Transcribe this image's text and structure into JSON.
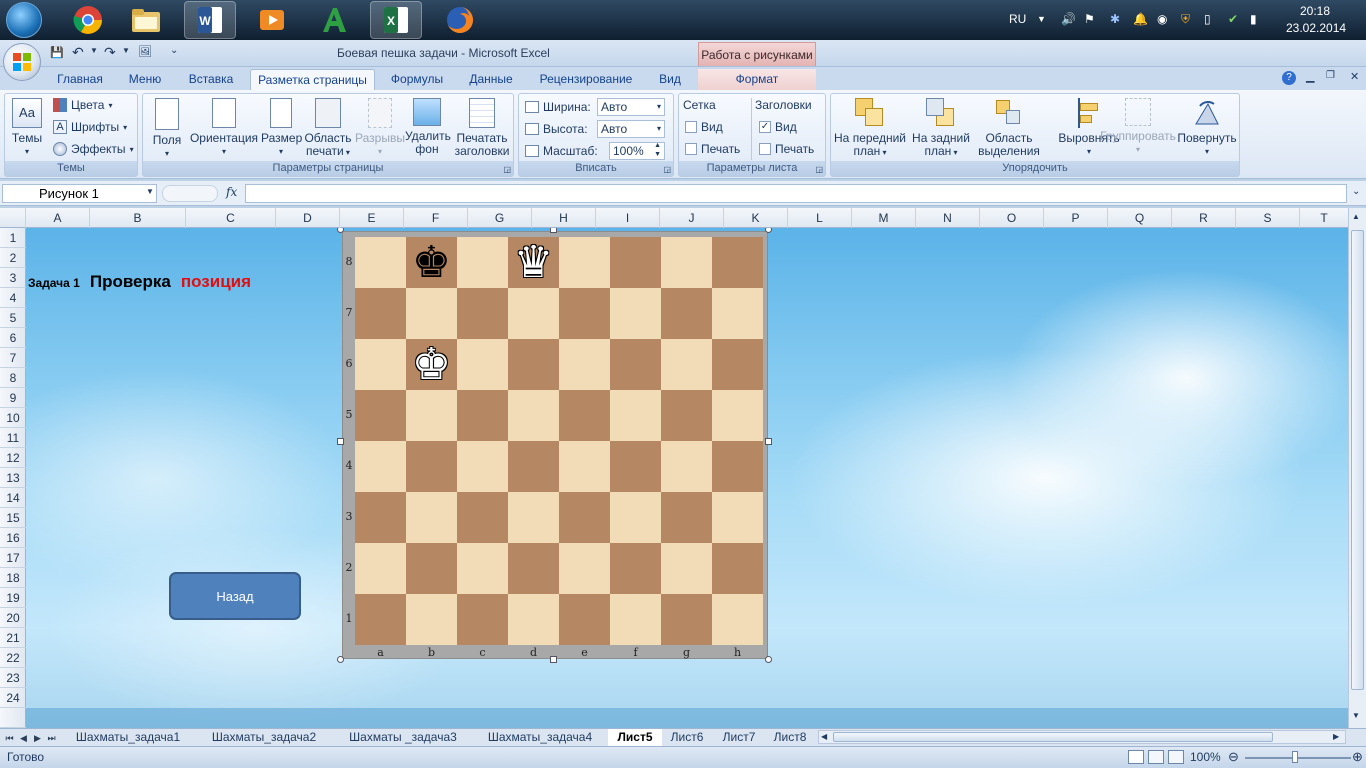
{
  "taskbar": {
    "apps": [
      {
        "icon": "chrome-icon"
      },
      {
        "icon": "file-explorer-icon"
      },
      {
        "icon": "word-icon"
      },
      {
        "icon": "media-player-icon"
      },
      {
        "icon": "font-a-icon"
      },
      {
        "icon": "excel-icon"
      },
      {
        "icon": "firefox-icon"
      }
    ],
    "lang": "RU",
    "time": "20:18",
    "date": "23.02.2014"
  },
  "window": {
    "title": "Боевая пешка задачи - Microsoft Excel",
    "context_tab": "Работа с рисунками"
  },
  "ribbon_tabs": [
    "Главная",
    "Меню",
    "Вставка",
    "Разметка страницы",
    "Формулы",
    "Данные",
    "Рецензирование",
    "Вид",
    "Формат"
  ],
  "ribbon": {
    "themes": {
      "label": "Темы",
      "themes_btn": "Темы",
      "colors": "Цвета",
      "fonts": "Шрифты",
      "effects": "Эффекты"
    },
    "page_setup": {
      "label": "Параметры страницы",
      "margins": "Поля",
      "orientation": "Ориентация",
      "size": "Размер",
      "print_area_1": "Область",
      "print_area_2": "печати",
      "breaks": "Разрывы",
      "background_1": "Удалить",
      "background_2": "фон",
      "print_titles_1": "Печатать",
      "print_titles_2": "заголовки"
    },
    "scale_to_fit": {
      "label": "Вписать",
      "width_label": "Ширина:",
      "width_value": "Авто",
      "height_label": "Высота:",
      "height_value": "Авто",
      "scale_label": "Масштаб:",
      "scale_value": "100%"
    },
    "sheet_options": {
      "label": "Параметры листа",
      "gridlines": "Сетка",
      "headings": "Заголовки",
      "view": "Вид",
      "print": "Печать",
      "gridlines_view_checked": false,
      "gridlines_print_checked": false,
      "headings_view_checked": true,
      "headings_print_checked": false
    },
    "arrange": {
      "label": "Упорядочить",
      "bring_forward_1": "На передний",
      "bring_forward_2": "план",
      "send_backward_1": "На задний",
      "send_backward_2": "план",
      "selection_pane_1": "Область",
      "selection_pane_2": "выделения",
      "align": "Выровнять",
      "group": "Группировать",
      "rotate": "Повернуть"
    }
  },
  "formula_bar": {
    "name_box": "Рисунок 1",
    "fx": "fx",
    "formula": ""
  },
  "columns": [
    "A",
    "B",
    "C",
    "D",
    "E",
    "F",
    "G",
    "H",
    "I",
    "J",
    "K",
    "L",
    "M",
    "N",
    "O",
    "P",
    "Q",
    "R",
    "S",
    "T"
  ],
  "rows": [
    "1",
    "2",
    "3",
    "4",
    "5",
    "6",
    "7",
    "8",
    "9",
    "10",
    "11",
    "12",
    "13",
    "14",
    "15",
    "16",
    "17",
    "18",
    "19",
    "20",
    "21",
    "22",
    "23",
    "24"
  ],
  "sheet_content": {
    "task_label": "Задача 1",
    "title_word1": "Проверка",
    "title_word2": "позиция",
    "back_button": "Назад"
  },
  "chess": {
    "ranks": [
      "8",
      "7",
      "6",
      "5",
      "4",
      "3",
      "2",
      "1"
    ],
    "files": [
      "a",
      "b",
      "c",
      "d",
      "e",
      "f",
      "g",
      "h"
    ],
    "pieces": [
      {
        "square": "b8",
        "piece": "king",
        "color": "black",
        "glyph": "♚"
      },
      {
        "square": "d8",
        "piece": "queen",
        "color": "white",
        "glyph": "♛"
      },
      {
        "square": "b6",
        "piece": "king",
        "color": "white",
        "glyph": "♚"
      }
    ],
    "light_color": "#f2dcb8",
    "dark_color": "#b58863"
  },
  "sheet_tabs": [
    {
      "label": "Шахматы_задача1",
      "active": false
    },
    {
      "label": "Шахматы_задача2",
      "active": false
    },
    {
      "label": "Шахматы _задача3",
      "active": false
    },
    {
      "label": "Шахматы_задача4",
      "active": false
    },
    {
      "label": "Лист5",
      "active": true
    },
    {
      "label": "Лист6",
      "active": false
    },
    {
      "label": "Лист7",
      "active": false
    },
    {
      "label": "Лист8",
      "active": false
    }
  ],
  "status": {
    "ready": "Готово",
    "zoom": "100%"
  }
}
